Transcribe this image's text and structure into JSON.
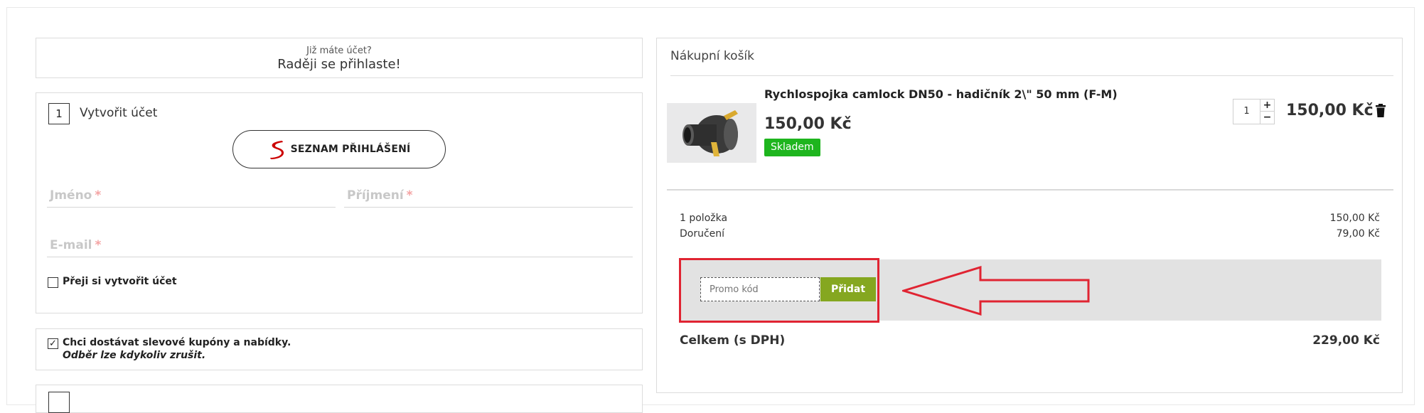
{
  "login": {
    "prompt": "Již máte účet?",
    "link": "Raději se přihlaste!"
  },
  "account": {
    "step_number": "1",
    "title": "Vytvořit účet",
    "seznam_button": "SEZNAM PŘIHLÁŠENÍ",
    "first_name_label": "Jméno",
    "last_name_label": "Příjmení",
    "email_label": "E-mail",
    "required_marker": "*",
    "create_account_checkbox": "Přeji si vytvořit účet"
  },
  "newsletter": {
    "label": "Chci dostávat slevové kupóny a nabídky.",
    "sublabel": "Odběr lze kdykoliv zrušit.",
    "checked": true,
    "check_glyph": "✓"
  },
  "cart": {
    "title": "Nákupní košík",
    "product": {
      "name": "Rychlospojka camlock DN50 - hadičník 2\\\" 50 mm (F-M)",
      "unit_price": "150,00 Kč",
      "stock": "Skladem",
      "quantity": "1",
      "line_total": "150,00 Kč",
      "plus": "+",
      "minus": "−"
    },
    "summary": {
      "items_label": "1 položka",
      "items_value": "150,00 Kč",
      "delivery_label": "Doručení",
      "delivery_value": "79,00 Kč"
    },
    "promo": {
      "placeholder": "Promo kód",
      "button": "Přidat"
    },
    "total": {
      "label": "Celkem (s DPH)",
      "value": "229,00 Kč"
    }
  },
  "colors": {
    "accent_green": "#85a720",
    "stock_green": "#1eb51e",
    "highlight_red": "#e02432"
  }
}
